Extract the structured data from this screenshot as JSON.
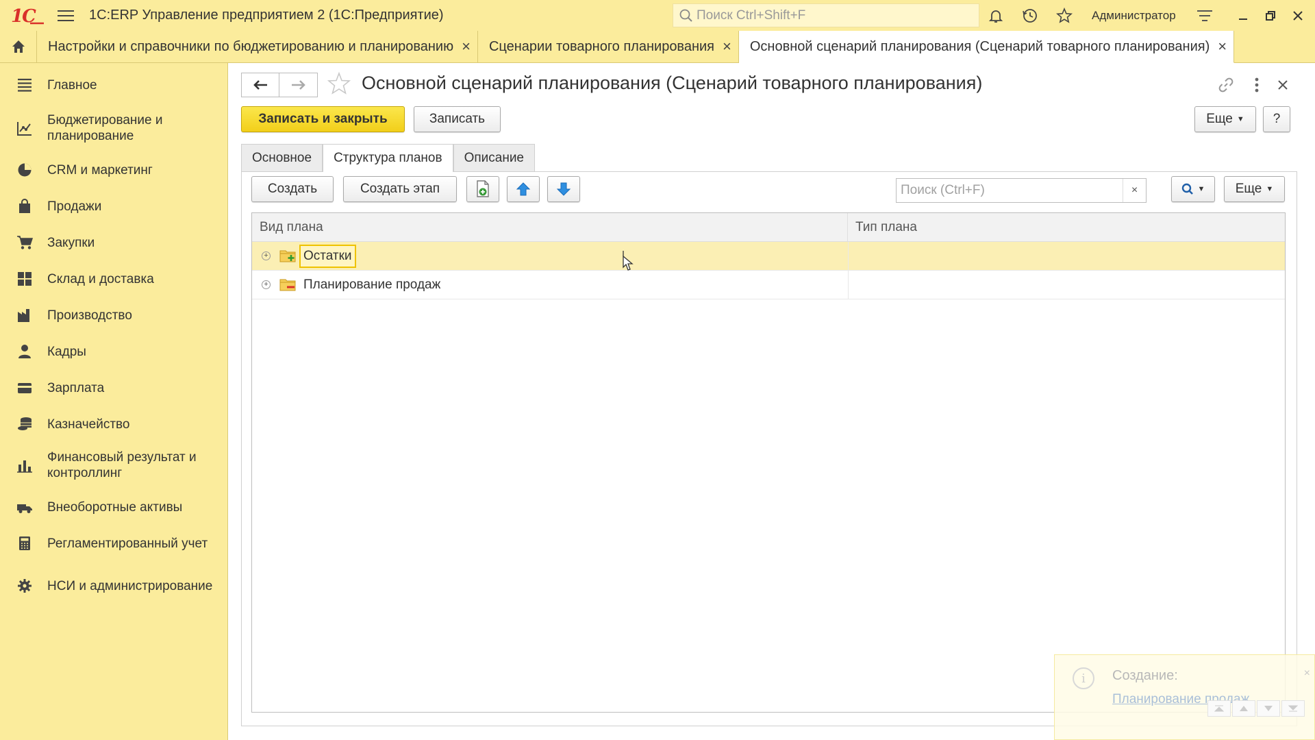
{
  "window": {
    "logo_text": "1C",
    "app_title": "1С:ERP Управление предприятием 2  (1С:Предприятие)",
    "search_placeholder": "Поиск Ctrl+Shift+F",
    "user_name": "Администратор",
    "icons": [
      "hamburger-menu-icon",
      "search-icon",
      "bell-icon",
      "history-icon",
      "star-icon",
      "settings-lines-icon",
      "minimize-icon",
      "restore-icon",
      "close-icon"
    ]
  },
  "tabs": [
    {
      "label": "Настройки и справочники по бюджетированию и планированию",
      "active": false
    },
    {
      "label": "Сценарии товарного планирования",
      "active": false
    },
    {
      "label": "Основной сценарий планирования (Сценарий товарного планирования)",
      "active": true
    }
  ],
  "tab_close_glyph": "×",
  "sidebar": {
    "items": [
      {
        "label": "Главное",
        "icon": "list-icon"
      },
      {
        "label": "Бюджетирование и планирование",
        "icon": "chart-icon"
      },
      {
        "label": "CRM и маркетинг",
        "icon": "pie-chart-icon"
      },
      {
        "label": "Продажи",
        "icon": "shopping-bag-icon"
      },
      {
        "label": "Закупки",
        "icon": "cart-icon"
      },
      {
        "label": "Склад и доставка",
        "icon": "warehouse-icon"
      },
      {
        "label": "Производство",
        "icon": "factory-icon"
      },
      {
        "label": "Кадры",
        "icon": "person-icon"
      },
      {
        "label": "Зарплата",
        "icon": "wallet-icon"
      },
      {
        "label": "Казначейство",
        "icon": "coins-icon"
      },
      {
        "label": "Финансовый результат и контроллинг",
        "icon": "bar-chart-icon"
      },
      {
        "label": "Внеоборотные активы",
        "icon": "truck-icon"
      },
      {
        "label": "Регламентированный учет",
        "icon": "calculator-icon"
      },
      {
        "label": "НСИ и администрирование",
        "icon": "gear-icon"
      }
    ]
  },
  "form": {
    "title": "Основной сценарий планирования (Сценарий товарного планирования)",
    "buttons": {
      "save_close": "Записать и закрыть",
      "save": "Записать",
      "more": "Еще",
      "help": "?"
    },
    "tabs": [
      {
        "label": "Основное",
        "active": false
      },
      {
        "label": "Структура планов",
        "active": true
      },
      {
        "label": "Описание",
        "active": false
      }
    ],
    "toolbar": {
      "create": "Создать",
      "create_stage": "Создать этап",
      "search_placeholder": "Поиск (Ctrl+F)",
      "search_clear": "×",
      "more": "Еще"
    },
    "table": {
      "columns": [
        "Вид плана",
        "Тип плана"
      ],
      "rows": [
        {
          "label": "Остатки",
          "type": "",
          "expander": "+",
          "icon": "folder-add-icon",
          "selected": true
        },
        {
          "label": "Планирование продаж",
          "type": "",
          "expander": "+",
          "icon": "folder-remove-icon",
          "selected": false
        }
      ]
    }
  },
  "notification": {
    "icon_glyph": "i",
    "title": "Создание:",
    "link": "Планирование продаж",
    "close": "×"
  },
  "colors": {
    "chrome_yellow": "#fbec9c",
    "primary_button": "#f2cf1a",
    "selected_row": "#fbefb4",
    "logo_red": "#d9302a"
  }
}
